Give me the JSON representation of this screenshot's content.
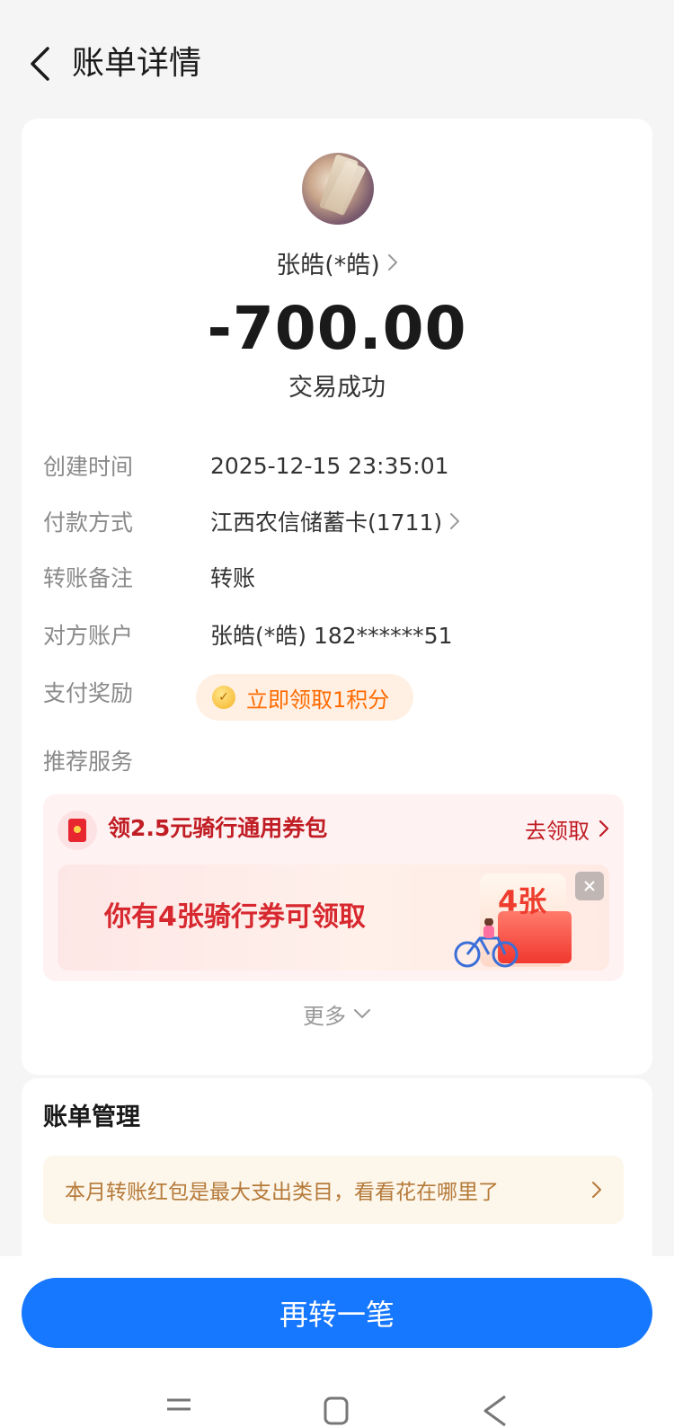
{
  "header": {
    "title": "账单详情"
  },
  "summary": {
    "payee": "张皓(*皓)",
    "amount": "-700.00",
    "status": "交易成功"
  },
  "details": [
    {
      "label": "创建时间",
      "value": "2025-12-15 23:35:01"
    },
    {
      "label": "付款方式",
      "value": "江西农信储蓄卡(1711)"
    },
    {
      "label": "转账备注",
      "value": "转账"
    },
    {
      "label": "对方账户",
      "value": "张皓(*皓) 182******51"
    },
    {
      "label": "支付奖励",
      "value": ""
    },
    {
      "label": "推荐服务",
      "value": ""
    }
  ],
  "reward": {
    "text": "立即领取1积分"
  },
  "promo": {
    "title": "领2.5元骑行通用券包",
    "action": "去领取",
    "banner_text": "你有4张骑行券可领取",
    "ticket_text": "4张"
  },
  "more": {
    "label": "更多"
  },
  "bill_management": {
    "title": "账单管理",
    "insight": "本月转账红包是最大支出类目，看看花在哪里了"
  },
  "primary_button": {
    "label": "再转一笔"
  },
  "colors": {
    "accent": "#1677ff",
    "promo_red": "#c01d24",
    "reward_orange": "#ff6a00",
    "insight_brown": "#b57a3a"
  }
}
